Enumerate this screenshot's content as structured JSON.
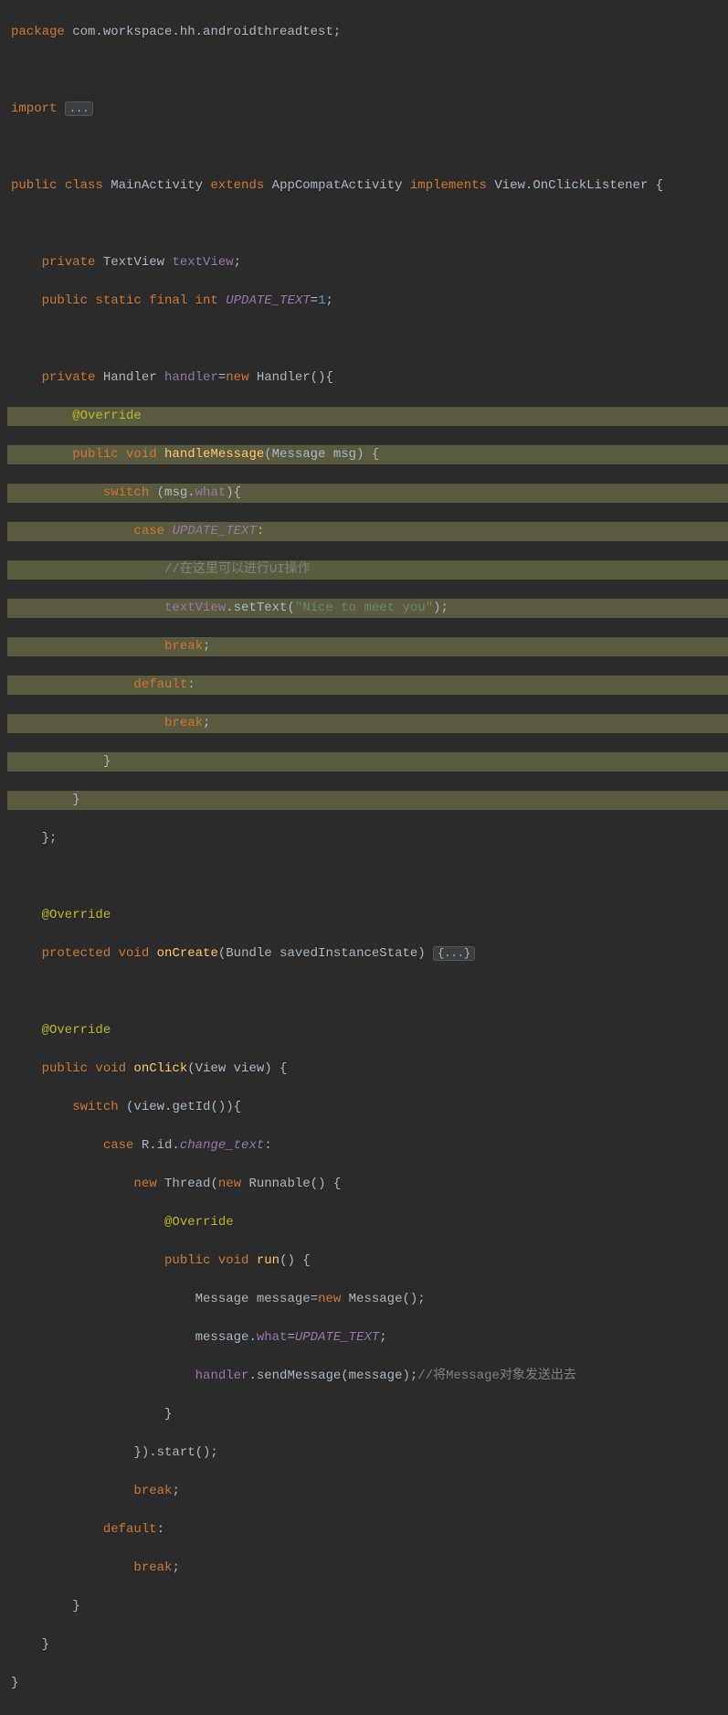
{
  "code": {
    "l1_package": "package",
    "l1_pkg": " com.workspace.hh.androidthreadtest",
    "l1_semi": ";",
    "l3_import": "import ",
    "l3_ellipsis": "...",
    "l5_public": "public ",
    "l5_class": "class ",
    "l5_name": "MainActivity ",
    "l5_extends": "extends ",
    "l5_super": "AppCompatActivity ",
    "l5_impl": "implements ",
    "l5_iface": "View.OnClickListener {",
    "l7_private": "    private ",
    "l7_type": "TextView ",
    "l7_field": "textView",
    "l7_semi": ";",
    "l8_mods": "    public static final int ",
    "l8_const": "UPDATE_TEXT",
    "l8_eq": "=",
    "l8_num": "1",
    "l8_semi": ";",
    "l10_private": "    private ",
    "l10_type": "Handler ",
    "l10_field": "handler",
    "l10_eq": "=",
    "l10_new": "new ",
    "l10_call": "Handler(){",
    "l11_anno": "        @Override",
    "l12_mods": "        public void ",
    "l12_method": "handleMessage",
    "l12_params": "(Message msg) {",
    "l13_switch": "            switch ",
    "l13_paren": "(msg.",
    "l13_what": "what",
    "l13_close": "){",
    "l14_case": "                case ",
    "l14_const": "UPDATE_TEXT",
    "l14_colon": ":",
    "l15_cmt": "                    //在这里可以进行UI操作",
    "l16_pad": "                    ",
    "l16_field": "textView",
    "l16_call": ".setText(",
    "l16_str": "\"Nice to meet you\"",
    "l16_end": ");",
    "l17_break": "                    break",
    "l17_semi": ";",
    "l18_default": "                default",
    "l18_colon": ":",
    "l19_break": "                    break",
    "l19_semi": ";",
    "l20_brace": "            }",
    "l21_brace": "        }",
    "l22_brace": "    };",
    "l24_anno": "    @Override",
    "l25_mods": "    protected void ",
    "l25_method": "onCreate",
    "l25_params": "(Bundle savedInstanceState) ",
    "l25_fold": "{...}",
    "l27_anno": "    @Override",
    "l28_mods": "    public void ",
    "l28_method": "onClick",
    "l28_params": "(View view) {",
    "l29_switch": "        switch ",
    "l29_expr": "(view.getId()){",
    "l30_case": "            case ",
    "l30_r": "R.id.",
    "l30_id": "change_text",
    "l30_colon": ":",
    "l31_new1": "                new ",
    "l31_thread": "Thread(",
    "l31_new2": "new ",
    "l31_runnable": "Runnable() {",
    "l32_anno": "                    @Override",
    "l33_mods": "                    public void ",
    "l33_method": "run",
    "l33_params": "() {",
    "l34_pad": "                        Message message=",
    "l34_new": "new ",
    "l34_msg": "Message();",
    "l35_pad": "                        message.",
    "l35_what": "what",
    "l35_eq": "=",
    "l35_const": "UPDATE_TEXT",
    "l35_semi": ";",
    "l36_pad": "                        ",
    "l36_handler": "handler",
    "l36_call": ".sendMessage(message);",
    "l36_cmt": "//将Message对象发送出去",
    "l37_brace": "                    }",
    "l38_brace": "                }).start();",
    "l39_break": "                break",
    "l39_semi": ";",
    "l40_default": "            default",
    "l40_colon": ":",
    "l41_break": "                break",
    "l41_semi": ";",
    "l42_brace": "        }",
    "l43_brace": "    }",
    "l44_brace": "}"
  }
}
